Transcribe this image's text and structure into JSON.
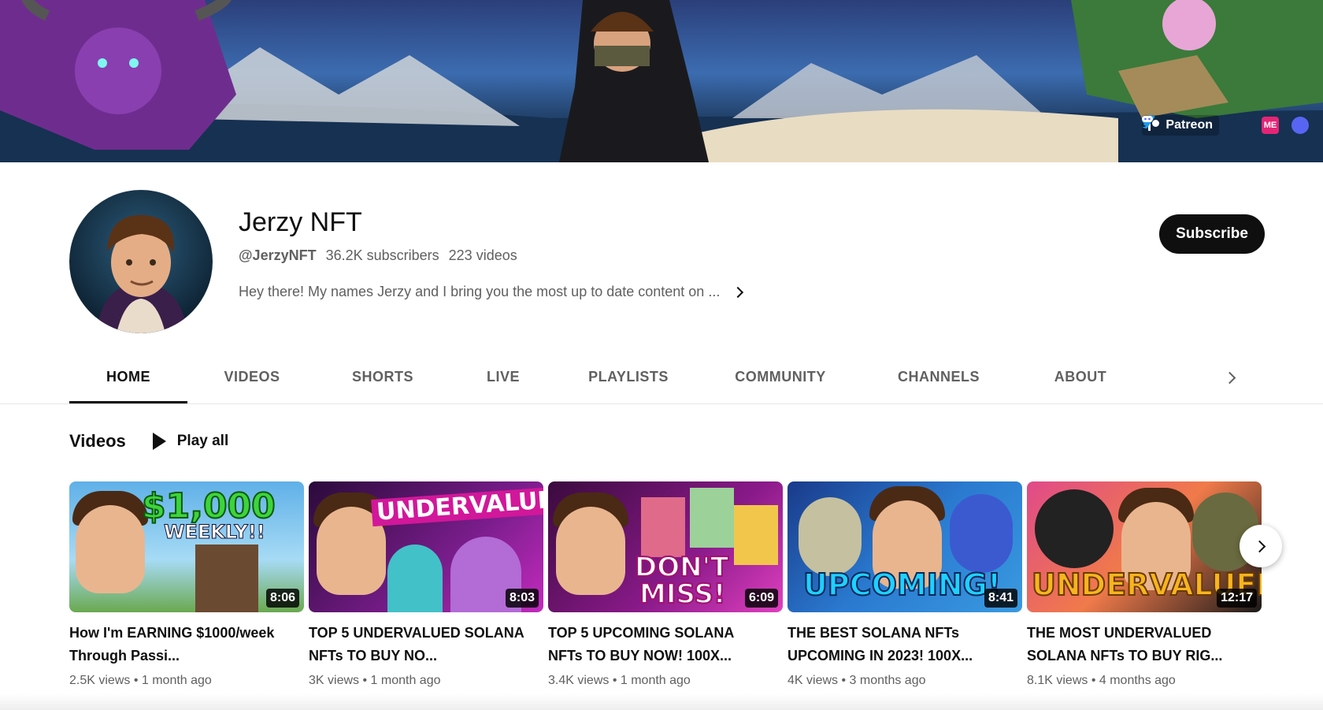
{
  "banner": {
    "links": [
      {
        "label": "Patreon",
        "icon": "patreon-icon"
      },
      {
        "label": "",
        "icon": "twitter-icon",
        "color": "#1d9bf0"
      },
      {
        "label": "",
        "icon": "magic-eden-icon",
        "color": "#e42575"
      },
      {
        "label": "",
        "icon": "discord-icon",
        "color": "#5865f2"
      }
    ]
  },
  "channel": {
    "name": "Jerzy NFT",
    "handle": "@JerzyNFT",
    "subscribers": "36.2K subscribers",
    "video_count": "223 videos",
    "description": "Hey there! My names Jerzy and I bring you the most up to date content on ...",
    "subscribe_label": "Subscribe"
  },
  "tabs": [
    {
      "label": "HOME",
      "active": true
    },
    {
      "label": "VIDEOS"
    },
    {
      "label": "SHORTS"
    },
    {
      "label": "LIVE"
    },
    {
      "label": "PLAYLISTS"
    },
    {
      "label": "COMMUNITY"
    },
    {
      "label": "CHANNELS"
    },
    {
      "label": "ABOUT"
    }
  ],
  "section": {
    "title": "Videos",
    "play_all": "Play all"
  },
  "videos": [
    {
      "title": "How I'm EARNING $1000/week Through Passi...",
      "views": "2.5K views",
      "age": "1 month ago",
      "duration": "8:06",
      "thumb_text": "$1,000",
      "thumb_text2": "WEEKLY!!"
    },
    {
      "title": "TOP 5 UNDERVALUED SOLANA NFTs TO BUY NO...",
      "views": "3K views",
      "age": "1 month ago",
      "duration": "8:03",
      "thumb_text": "UNDERVALUED",
      "thumb_text2": ""
    },
    {
      "title": "TOP 5 UPCOMING SOLANA NFTs TO BUY NOW! 100X...",
      "views": "3.4K views",
      "age": "1 month ago",
      "duration": "6:09",
      "thumb_text": "DON'T",
      "thumb_text2": "MISS!"
    },
    {
      "title": "THE BEST SOLANA NFTs UPCOMING IN 2023! 100X...",
      "views": "4K views",
      "age": "3 months ago",
      "duration": "8:41",
      "thumb_text": "UPCOMING!",
      "thumb_text2": ""
    },
    {
      "title": "THE MOST UNDERVALUED SOLANA NFTs TO BUY RIG...",
      "views": "8.1K views",
      "age": "4 months ago",
      "duration": "12:17",
      "thumb_text": "UNDERVALUED",
      "thumb_text2": ""
    }
  ]
}
